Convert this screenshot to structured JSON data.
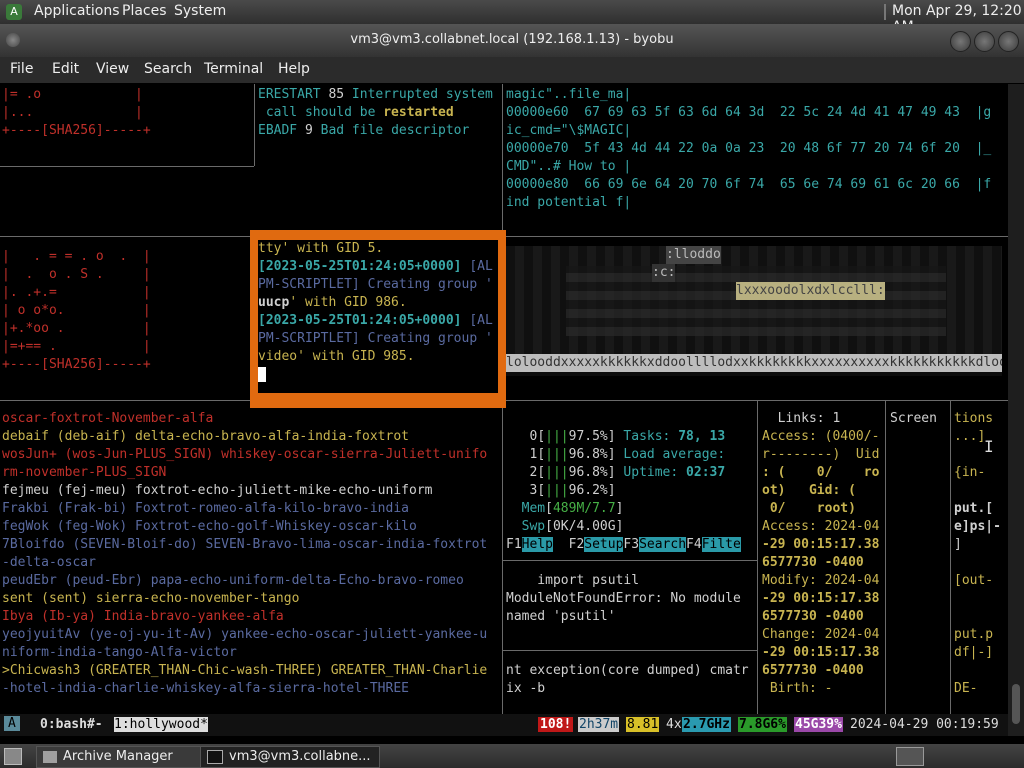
{
  "panel": {
    "menus": [
      "Applications",
      "Places",
      "System"
    ],
    "clock": "Mon Apr 29, 12:20 AM"
  },
  "window": {
    "title": "vm3@vm3.collabnet.local (192.168.1.13) - byobu"
  },
  "menubar": [
    "File",
    "Edit",
    "View",
    "Search",
    "Terminal",
    "Help"
  ],
  "panes": {
    "sha_top": [
      "|= .o            |",
      "|...             |",
      "+----[SHA256]-----+"
    ],
    "errors": [
      {
        "a": "ERESTART",
        "n": "85",
        "msg": " Interrupted system"
      },
      {
        "a": "",
        "n": "",
        "msg": " call should be ",
        "bold": "restarted"
      },
      {
        "a": "EBADF",
        "n": "9",
        "msg": " Bad file descriptor"
      }
    ],
    "hexdump": [
      "magic\"..file_ma|",
      "00000e60  67 69 63 5f 63 6d 64 3d  22 5c 24 4d 41 47 49 43  |g",
      "ic_cmd=\"\\$MAGIC|",
      "00000e70  5f 43 4d 44 22 0a 0a 23  20 48 6f 77 20 74 6f 20  |_",
      "CMD\"..# How to |",
      "00000e80  66 69 6e 64 20 70 6f 74  65 6e 74 69 61 6c 20 66  |f",
      "ind potential f|"
    ],
    "sha_mid": [
      "|   . = = . o  .  |",
      "|  .  o . S .     |",
      "|. .+.=           |",
      "| o o*o.          |",
      "|+.*oo .          |",
      "|=+== .           |",
      "+----[SHA256]-----+"
    ],
    "overlay_lines": [
      {
        "t": "tty' with GID 5.",
        "c": "yl"
      },
      {
        "ts": "[2023-05-25T01:24:05+0000]",
        "rest": " [AL"
      },
      {
        "t": "PM-SCRIPTLET] Creating group '",
        "c": "bl"
      },
      {
        "bold": "uucp",
        "t": "' with GID 986.",
        "c": "yl"
      },
      {
        "ts": "[2023-05-25T01:24:05+0000]",
        "rest": " [AL"
      },
      {
        "t": "PM-SCRIPTLET] Creating group '",
        "c": "bl"
      },
      {
        "t": "video' with GID 985.",
        "c": "yl"
      }
    ],
    "ascii_art_bottom": "lolooddxxxxxkkkkkkxddoollllodxxkkkkkkkkxxxxxxxxxxkkkkkkkkkkkdloo",
    "ascii_art_mid": "lxxxoodolxdxlcclll:",
    "ascii_art_top": ":lloddo",
    "ascii_art_c": ":c:",
    "hollywood_words": [
      {
        "t": "oscar-foxtrot-November-alfa",
        "c": "red"
      },
      {
        "t": "debaif (deb-aif) delta-echo-bravo-alfa-india-foxtrot",
        "c": "yl"
      },
      {
        "t": "wosJun+ (wos-Jun-PLUS_SIGN) whiskey-oscar-sierra-Juliett-unifo",
        "c": "red"
      },
      {
        "t": "rm-november-PLUS_SIGN",
        "c": "red"
      },
      {
        "t": "fejmeu (fej-meu) foxtrot-echo-juliett-mike-echo-uniform",
        "c": "wt"
      },
      {
        "t": "Frakbi (Frak-bi) Foxtrot-romeo-alfa-kilo-bravo-india",
        "c": "bl"
      },
      {
        "t": "fegWok (feg-Wok) Foxtrot-echo-golf-Whiskey-oscar-kilo",
        "c": "bl"
      },
      {
        "t": "7Bloifdo (SEVEN-Bloif-do) SEVEN-Bravo-lima-oscar-india-foxtrot",
        "c": "bl"
      },
      {
        "t": "-delta-oscar",
        "c": "bl"
      },
      {
        "t": "peudEbr (peud-Ebr) papa-echo-uniform-delta-Echo-bravo-romeo",
        "c": "bl"
      },
      {
        "t": "sent (sent) sierra-echo-november-tango",
        "c": "yl"
      },
      {
        "t": "Ibya (Ib-ya) India-bravo-yankee-alfa",
        "c": "red"
      },
      {
        "t": "yeojyuitAv (ye-oj-yu-it-Av) yankee-echo-oscar-juliett-yankee-u",
        "c": "bl"
      },
      {
        "t": "niform-india-tango-Alfa-victor",
        "c": "bl"
      },
      {
        "t": ">Chicwash3 (GREATER_THAN-Chic-wash-THREE) GREATER_THAN-Charlie",
        "c": "yl"
      },
      {
        "t": "-hotel-india-charlie-whiskey-alfa-sierra-hotel-THREE",
        "c": "bl"
      }
    ],
    "htop": {
      "cpus": [
        {
          "n": "0",
          "bar": "|||",
          "pct": "97.5%"
        },
        {
          "n": "1",
          "bar": "|||",
          "pct": "96.8%"
        },
        {
          "n": "2",
          "bar": "|||",
          "pct": "96.8%"
        },
        {
          "n": "3",
          "bar": "|||",
          "pct": "96.2%"
        }
      ],
      "tasks_label": "Tasks:",
      "tasks": "78, 13",
      "load_label": "Load average:",
      "uptime_label": "Uptime:",
      "uptime": "02:37",
      "mem_label": "Mem",
      "mem_val": "489M/7.7",
      "swp_label": "Swp",
      "swp_val": "0K/4.00G",
      "fkeys": [
        {
          "k": "F1",
          "l": "Help"
        },
        {
          "k": "F2",
          "l": "Setup"
        },
        {
          "k": "F3",
          "l": "Search"
        },
        {
          "k": "F4",
          "l": "Filte"
        }
      ]
    },
    "python_err": [
      "    import psutil",
      "ModuleNotFoundError: No module",
      "named 'psutil'"
    ],
    "core_dump": [
      "nt exception(core dumped) cmatr",
      "ix -b"
    ],
    "stat": [
      {
        "t": "  Links: 1"
      },
      {
        "t": "Access: (0400/-"
      },
      {
        "t": "r--------)  Uid"
      },
      {
        "t": ": (    0/    ro"
      },
      {
        "t": "ot)   Gid: ("
      },
      {
        "t": " 0/    root)"
      },
      {
        "t": "Access: 2024-04"
      },
      {
        "t": "-29 00:15:17.38"
      },
      {
        "t": "6577730 -0400"
      },
      {
        "t": "Modify: 2024-04"
      },
      {
        "t": "-29 00:15:17.38"
      },
      {
        "t": "6577730 -0400"
      },
      {
        "t": "Change: 2024-04"
      },
      {
        "t": "-29 00:15:17.38"
      },
      {
        "t": "6577730 -0400"
      },
      {
        "t": " Birth: -"
      }
    ],
    "screen_label": "Screen",
    "right_col": [
      "tions",
      "...]",
      "",
      "{in-",
      "",
      "put.[",
      "e]ps|-",
      "]",
      "",
      "[out-",
      "",
      "",
      "put.p",
      "df|-]",
      "",
      "DE-"
    ]
  },
  "status": {
    "a": "A",
    "win0": "0:bash#-",
    "win1": "1:hollywood*",
    "s108": "108!",
    "uptime": "2h37m",
    "load": "8.81",
    "cpu": "4x",
    "ghz": "2.7GHz",
    "mem": "7.8G6%",
    "disk": "45G39%",
    "datetime": "2024-04-29 00:19:59"
  },
  "taskbar": {
    "items": [
      "Archive Manager",
      "vm3@vm3.collabne..."
    ]
  }
}
